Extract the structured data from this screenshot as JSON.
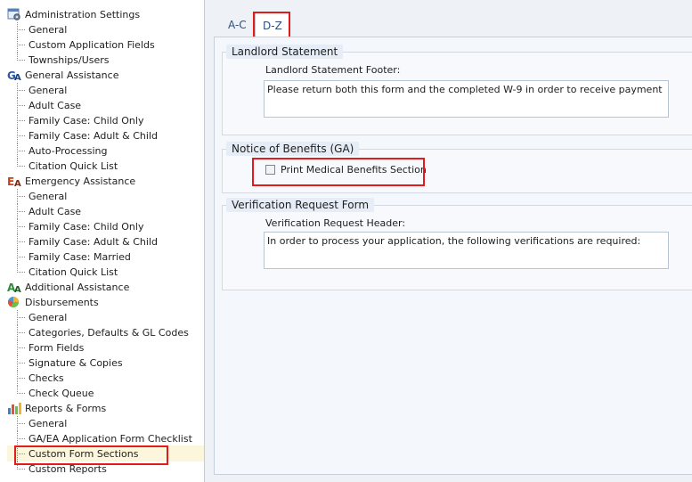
{
  "tree": {
    "categories": [
      {
        "label": "Administration Settings",
        "icon": "admin-settings-icon",
        "items": [
          "General",
          "Custom Application Fields",
          "Townships/Users"
        ]
      },
      {
        "label": "General Assistance",
        "icon": "ga-icon",
        "items": [
          "General",
          "Adult Case",
          "Family Case: Child Only",
          "Family Case: Adult & Child",
          "Auto-Processing",
          "Citation Quick List"
        ]
      },
      {
        "label": "Emergency Assistance",
        "icon": "ea-icon",
        "items": [
          "General",
          "Adult Case",
          "Family Case: Child Only",
          "Family Case: Adult & Child",
          "Family Case: Married",
          "Citation Quick List"
        ]
      },
      {
        "label": "Additional Assistance",
        "icon": "aa-icon",
        "items": []
      },
      {
        "label": "Disbursements",
        "icon": "pie-chart-icon",
        "items": [
          "General",
          "Categories, Defaults & GL Codes",
          "Form Fields",
          "Signature & Copies",
          "Checks",
          "Check Queue"
        ]
      },
      {
        "label": "Reports & Forms",
        "icon": "bar-chart-icon",
        "items": [
          "General",
          "GA/EA Application Form Checklist",
          "Custom Form Sections",
          "Custom Reports"
        ]
      }
    ],
    "selected": "Custom Form Sections"
  },
  "tabs": [
    {
      "label": "A-C",
      "active": false
    },
    {
      "label": "D-Z",
      "active": true
    }
  ],
  "sections": {
    "landlord": {
      "title": "Landlord Statement",
      "field_label": "Landlord Statement Footer:",
      "value": "Please return both this form and the completed W-9 in order to receive payment"
    },
    "benefits": {
      "title": "Notice of Benefits (GA)",
      "checkbox_label": "Print Medical Benefits Section",
      "checked": false
    },
    "verification": {
      "title": "Verification Request Form",
      "field_label": "Verification Request Header:",
      "value": "In order to process your application, the following verifications are required:"
    }
  }
}
